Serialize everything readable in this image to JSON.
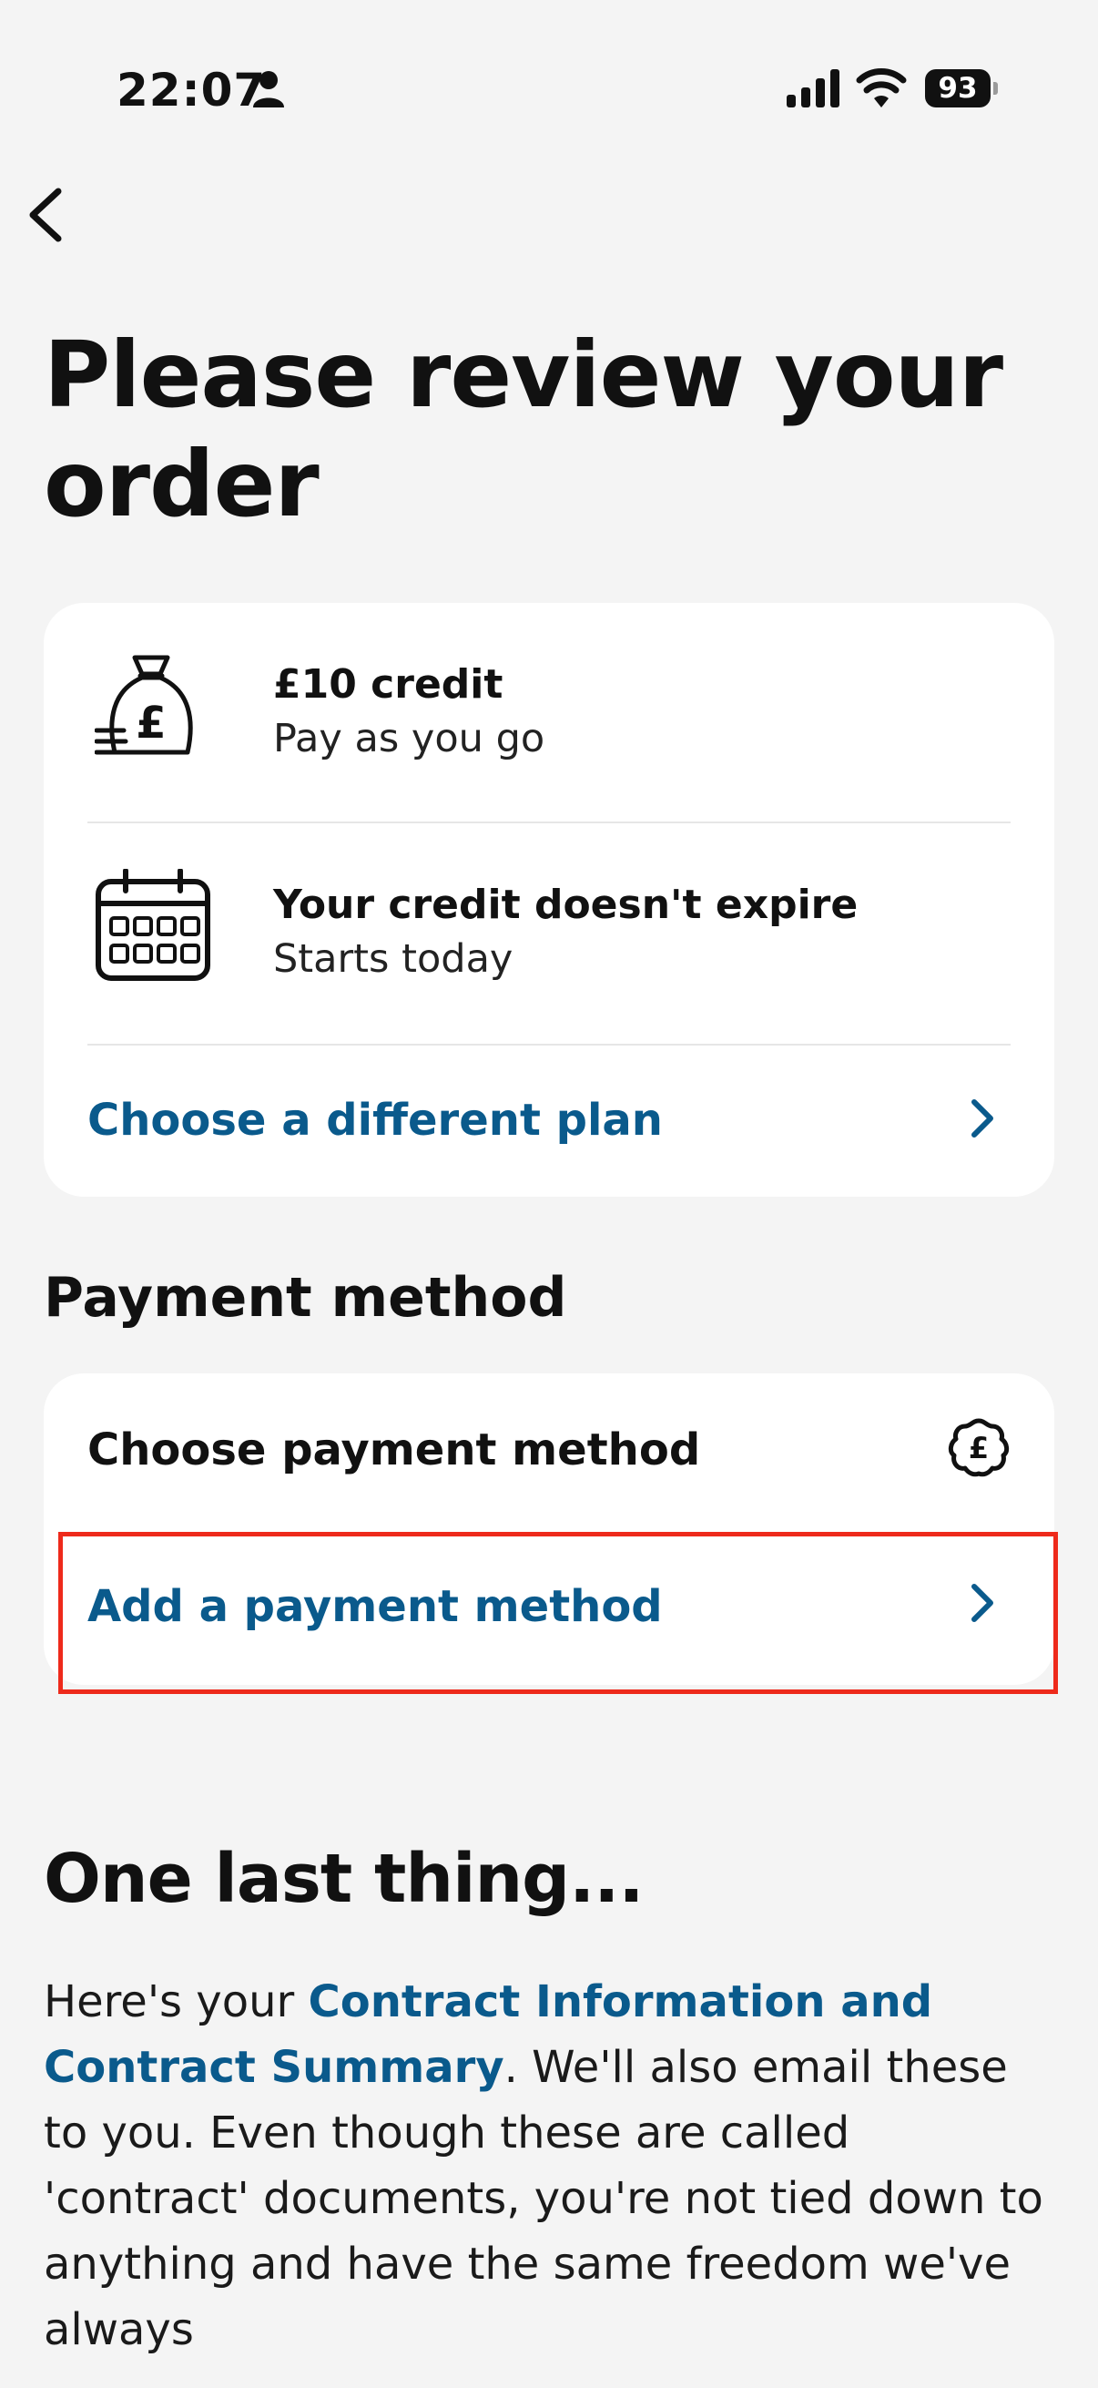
{
  "status_bar": {
    "time": "22:07",
    "battery": "93"
  },
  "page": {
    "title": "Please review your order"
  },
  "plan_card": {
    "credit": {
      "title": "£10 credit",
      "subtitle": "Pay as you go"
    },
    "expiry": {
      "title": "Your credit doesn't expire",
      "subtitle": "Starts today"
    },
    "change_plan_link": "Choose a different plan"
  },
  "payment": {
    "section_title": "Payment method",
    "header_label": "Choose payment method",
    "add_link": "Add a payment method"
  },
  "last_thing": {
    "title": "One last thing...",
    "text_before": "Here's your ",
    "link_text": "Contract Information and Contract Summary",
    "text_after": ". We'll also email these to you. Even though these are called 'contract' documents, you're not tied down to anything and have the same freedom we've always"
  },
  "colors": {
    "link": "#0a5a8c",
    "highlight": "#ee2a1b",
    "background": "#f4f4f4",
    "card": "#ffffff"
  },
  "icons": {
    "back": "chevron-left-icon",
    "credit": "money-bag-pound-icon",
    "calendar": "calendar-icon",
    "chevron": "chevron-right-icon",
    "badge": "pound-badge-icon"
  }
}
